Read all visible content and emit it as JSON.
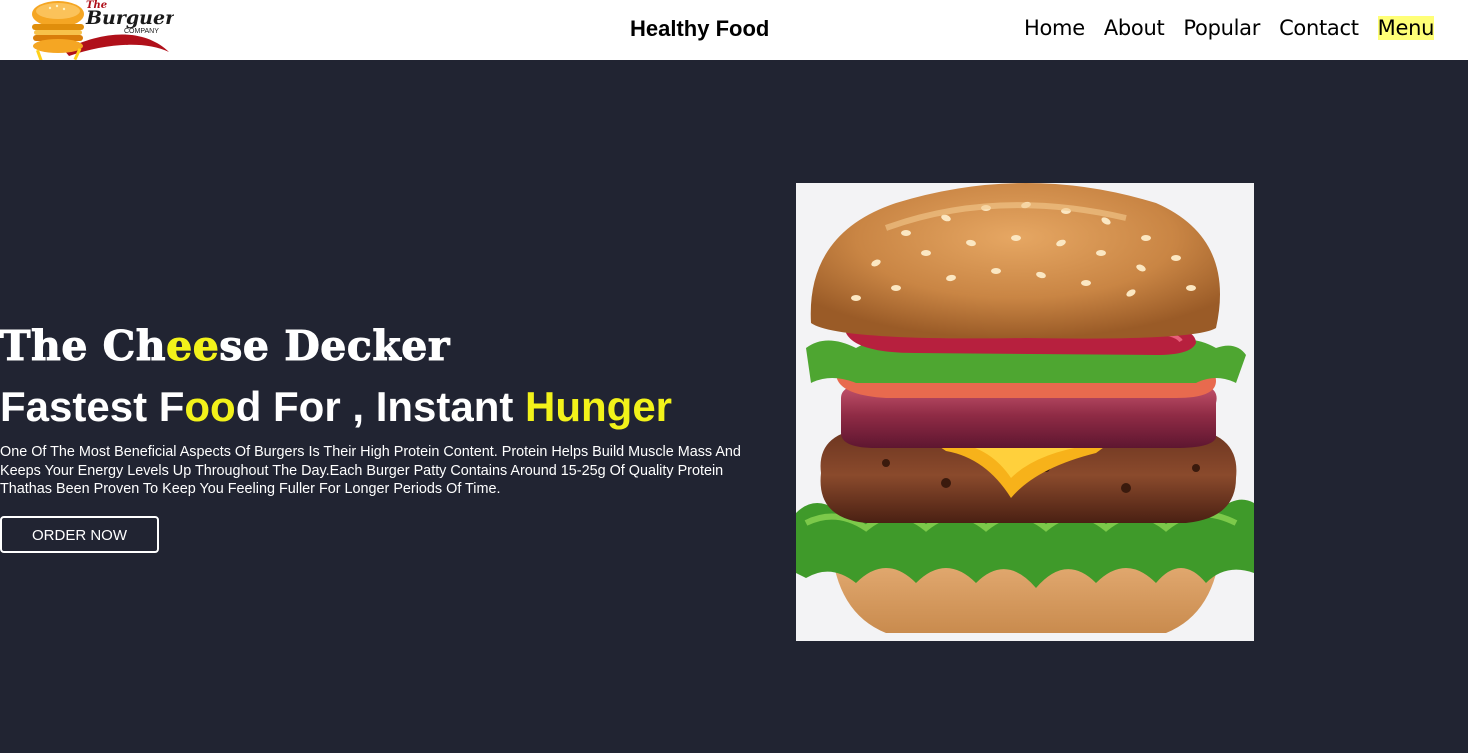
{
  "logo": {
    "line1": "The",
    "line2": "Burguer",
    "line3": "COMPANY"
  },
  "header": {
    "title": "Healthy Food"
  },
  "nav": {
    "items": [
      {
        "label": "Home"
      },
      {
        "label": "About"
      },
      {
        "label": "Popular"
      },
      {
        "label": "Contact"
      },
      {
        "label": "Menu"
      }
    ],
    "active_item": "Menu",
    "active_highlight": "#ffff77"
  },
  "hero": {
    "title_part1": "The Ch",
    "title_highlight": "ee",
    "title_part2": "se Decker",
    "subtitle_part1": "Fastest F",
    "subtitle_highlight1": "oo",
    "subtitle_part2": "d For , Instant ",
    "subtitle_highlight2": "Hunger",
    "description": "One Of The Most Beneficial Aspects Of Burgers Is Their High Protein Content. Protein Helps Build Muscle Mass And Keeps Your Energy Levels Up Throughout The Day.Each Burger Patty Contains Around 15-25g Of Quality Protein Thathas Been Proven To Keep You Feeling Fuller For Longer Periods Of Time.",
    "button_label": "ORDER NOW",
    "image_icon": "burger-photo"
  },
  "colors": {
    "hero_background": "#212432",
    "accent_yellow": "#f2f21a",
    "text_white": "#ffffff",
    "header_background": "#ffffff"
  }
}
